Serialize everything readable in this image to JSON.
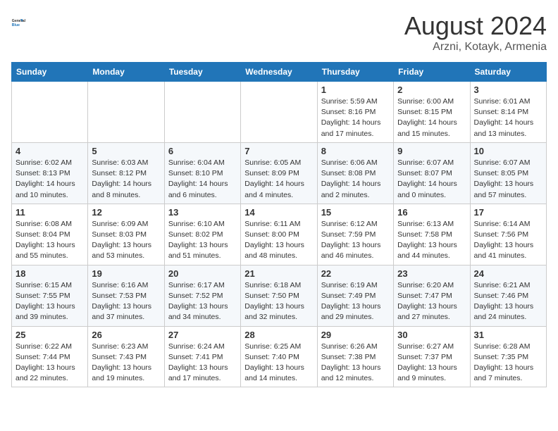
{
  "header": {
    "logo_general": "General",
    "logo_blue": "Blue",
    "month_title": "August 2024",
    "location": "Arzni, Kotayk, Armenia"
  },
  "weekdays": [
    "Sunday",
    "Monday",
    "Tuesday",
    "Wednesday",
    "Thursday",
    "Friday",
    "Saturday"
  ],
  "weeks": [
    [
      {
        "day": "",
        "content": ""
      },
      {
        "day": "",
        "content": ""
      },
      {
        "day": "",
        "content": ""
      },
      {
        "day": "",
        "content": ""
      },
      {
        "day": "1",
        "content": "Sunrise: 5:59 AM\nSunset: 8:16 PM\nDaylight: 14 hours\nand 17 minutes."
      },
      {
        "day": "2",
        "content": "Sunrise: 6:00 AM\nSunset: 8:15 PM\nDaylight: 14 hours\nand 15 minutes."
      },
      {
        "day": "3",
        "content": "Sunrise: 6:01 AM\nSunset: 8:14 PM\nDaylight: 14 hours\nand 13 minutes."
      }
    ],
    [
      {
        "day": "4",
        "content": "Sunrise: 6:02 AM\nSunset: 8:13 PM\nDaylight: 14 hours\nand 10 minutes."
      },
      {
        "day": "5",
        "content": "Sunrise: 6:03 AM\nSunset: 8:12 PM\nDaylight: 14 hours\nand 8 minutes."
      },
      {
        "day": "6",
        "content": "Sunrise: 6:04 AM\nSunset: 8:10 PM\nDaylight: 14 hours\nand 6 minutes."
      },
      {
        "day": "7",
        "content": "Sunrise: 6:05 AM\nSunset: 8:09 PM\nDaylight: 14 hours\nand 4 minutes."
      },
      {
        "day": "8",
        "content": "Sunrise: 6:06 AM\nSunset: 8:08 PM\nDaylight: 14 hours\nand 2 minutes."
      },
      {
        "day": "9",
        "content": "Sunrise: 6:07 AM\nSunset: 8:07 PM\nDaylight: 14 hours\nand 0 minutes."
      },
      {
        "day": "10",
        "content": "Sunrise: 6:07 AM\nSunset: 8:05 PM\nDaylight: 13 hours\nand 57 minutes."
      }
    ],
    [
      {
        "day": "11",
        "content": "Sunrise: 6:08 AM\nSunset: 8:04 PM\nDaylight: 13 hours\nand 55 minutes."
      },
      {
        "day": "12",
        "content": "Sunrise: 6:09 AM\nSunset: 8:03 PM\nDaylight: 13 hours\nand 53 minutes."
      },
      {
        "day": "13",
        "content": "Sunrise: 6:10 AM\nSunset: 8:02 PM\nDaylight: 13 hours\nand 51 minutes."
      },
      {
        "day": "14",
        "content": "Sunrise: 6:11 AM\nSunset: 8:00 PM\nDaylight: 13 hours\nand 48 minutes."
      },
      {
        "day": "15",
        "content": "Sunrise: 6:12 AM\nSunset: 7:59 PM\nDaylight: 13 hours\nand 46 minutes."
      },
      {
        "day": "16",
        "content": "Sunrise: 6:13 AM\nSunset: 7:58 PM\nDaylight: 13 hours\nand 44 minutes."
      },
      {
        "day": "17",
        "content": "Sunrise: 6:14 AM\nSunset: 7:56 PM\nDaylight: 13 hours\nand 41 minutes."
      }
    ],
    [
      {
        "day": "18",
        "content": "Sunrise: 6:15 AM\nSunset: 7:55 PM\nDaylight: 13 hours\nand 39 minutes."
      },
      {
        "day": "19",
        "content": "Sunrise: 6:16 AM\nSunset: 7:53 PM\nDaylight: 13 hours\nand 37 minutes."
      },
      {
        "day": "20",
        "content": "Sunrise: 6:17 AM\nSunset: 7:52 PM\nDaylight: 13 hours\nand 34 minutes."
      },
      {
        "day": "21",
        "content": "Sunrise: 6:18 AM\nSunset: 7:50 PM\nDaylight: 13 hours\nand 32 minutes."
      },
      {
        "day": "22",
        "content": "Sunrise: 6:19 AM\nSunset: 7:49 PM\nDaylight: 13 hours\nand 29 minutes."
      },
      {
        "day": "23",
        "content": "Sunrise: 6:20 AM\nSunset: 7:47 PM\nDaylight: 13 hours\nand 27 minutes."
      },
      {
        "day": "24",
        "content": "Sunrise: 6:21 AM\nSunset: 7:46 PM\nDaylight: 13 hours\nand 24 minutes."
      }
    ],
    [
      {
        "day": "25",
        "content": "Sunrise: 6:22 AM\nSunset: 7:44 PM\nDaylight: 13 hours\nand 22 minutes."
      },
      {
        "day": "26",
        "content": "Sunrise: 6:23 AM\nSunset: 7:43 PM\nDaylight: 13 hours\nand 19 minutes."
      },
      {
        "day": "27",
        "content": "Sunrise: 6:24 AM\nSunset: 7:41 PM\nDaylight: 13 hours\nand 17 minutes."
      },
      {
        "day": "28",
        "content": "Sunrise: 6:25 AM\nSunset: 7:40 PM\nDaylight: 13 hours\nand 14 minutes."
      },
      {
        "day": "29",
        "content": "Sunrise: 6:26 AM\nSunset: 7:38 PM\nDaylight: 13 hours\nand 12 minutes."
      },
      {
        "day": "30",
        "content": "Sunrise: 6:27 AM\nSunset: 7:37 PM\nDaylight: 13 hours\nand 9 minutes."
      },
      {
        "day": "31",
        "content": "Sunrise: 6:28 AM\nSunset: 7:35 PM\nDaylight: 13 hours\nand 7 minutes."
      }
    ]
  ]
}
